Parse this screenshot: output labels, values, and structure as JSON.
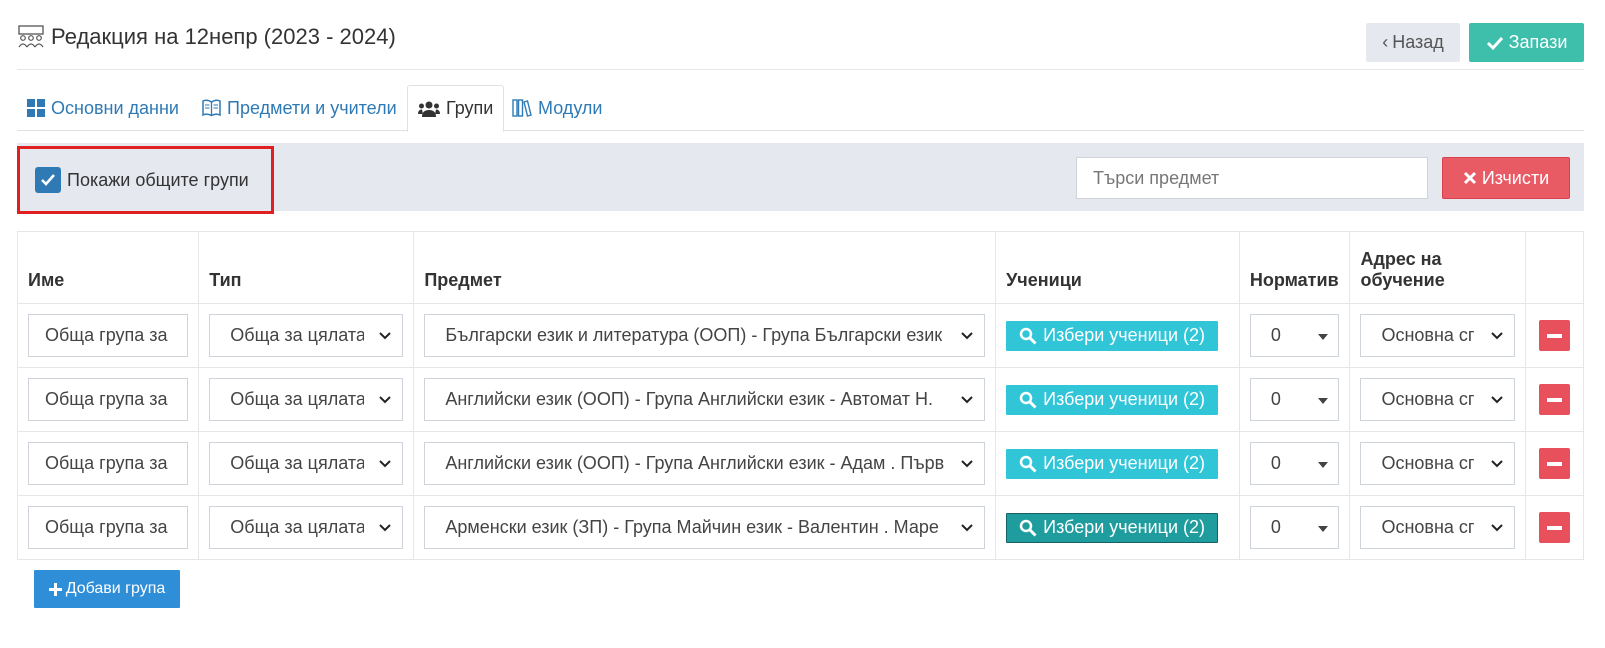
{
  "header": {
    "title": "Редакция на 12непр (2023 - 2024)",
    "back_label": "Назад",
    "save_label": "Запази"
  },
  "tabs": [
    {
      "label": "Основни данни",
      "icon": "grid-icon"
    },
    {
      "label": "Предмети и учители",
      "icon": "book-icon"
    },
    {
      "label": "Групи",
      "icon": "users-icon",
      "active": true
    },
    {
      "label": "Модули",
      "icon": "books-icon"
    }
  ],
  "filter": {
    "show_common_label": "Покажи общите групи",
    "show_common_checked": true,
    "search_placeholder": "Търси предмет",
    "clear_label": "Изчисти"
  },
  "table": {
    "columns": [
      "Име",
      "Тип",
      "Предмет",
      "Ученици",
      "Норматив",
      "Адрес на обучение"
    ],
    "rows": [
      {
        "name": "Обща група за",
        "type": "Обща за цялата",
        "subject": "Български език и литература (ООП) - Група Български език",
        "students_label": "Избери ученици (2)",
        "norm": "0",
        "address": "Основна сг"
      },
      {
        "name": "Обща група за",
        "type": "Обща за цялата",
        "subject": "Английски език (ООП) - Група Английски език - Автомат Н.",
        "students_label": "Избери ученици (2)",
        "norm": "0",
        "address": "Основна сг"
      },
      {
        "name": "Обща група за",
        "type": "Обща за цялата",
        "subject": "Английски език (ООП) - Група Английски език - Адам . Първ",
        "students_label": "Избери ученици (2)",
        "norm": "0",
        "address": "Основна сг"
      },
      {
        "name": "Обща група за",
        "type": "Обща за цялата",
        "subject": "Арменски език (ЗП) - Група Майчин език - Валентин . Маре",
        "students_label": "Избери ученици (2)",
        "norm": "0",
        "address": "Основна сг"
      }
    ]
  },
  "add_group_label": "Добави група",
  "colors": {
    "primary": "#2f7ab5",
    "save": "#3ebfac",
    "danger": "#e8505b",
    "info": "#31c5d8",
    "highlight_border": "#e02020"
  }
}
